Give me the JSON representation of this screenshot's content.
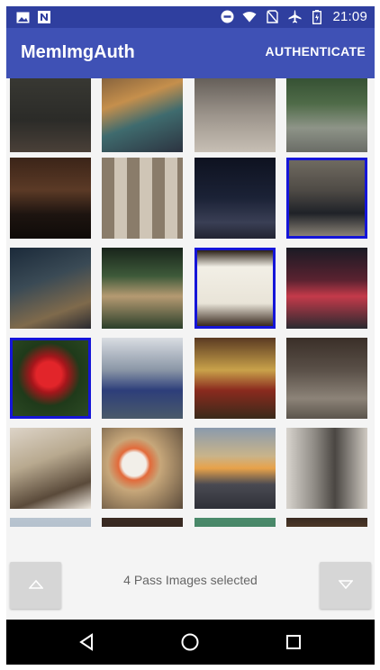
{
  "status_bar": {
    "time": "21:09",
    "left_icons": [
      "image-icon",
      "n-notification-icon"
    ],
    "right_icons": [
      "do-not-disturb-icon",
      "wifi-icon",
      "no-sim-icon",
      "airplane-icon",
      "battery-icon"
    ]
  },
  "app_bar": {
    "title": "MemImgAuth",
    "action_label": "AUTHENTICATE"
  },
  "grid": {
    "columns": 4,
    "selected_count": 4,
    "rows": [
      [
        {
          "name": "photo-red-bicycle",
          "selected": false
        },
        {
          "name": "photo-market-stall",
          "selected": false
        },
        {
          "name": "photo-street-sacks",
          "selected": false
        },
        {
          "name": "photo-tree-lined-road",
          "selected": false
        }
      ],
      [
        {
          "name": "photo-concert-hall",
          "selected": false
        },
        {
          "name": "photo-bookshelves",
          "selected": false
        },
        {
          "name": "photo-night-city",
          "selected": false
        },
        {
          "name": "photo-people-backpacks",
          "selected": true
        }
      ],
      [
        {
          "name": "photo-office-desk",
          "selected": false
        },
        {
          "name": "photo-pagoda-tree",
          "selected": false
        },
        {
          "name": "photo-sake-sign",
          "selected": true
        },
        {
          "name": "photo-neon-street",
          "selected": false
        }
      ],
      [
        {
          "name": "photo-red-rose",
          "selected": true
        },
        {
          "name": "photo-crowd-blue",
          "selected": false
        },
        {
          "name": "photo-lucky-figurine",
          "selected": false
        },
        {
          "name": "photo-exhibition-hall",
          "selected": false
        }
      ],
      [
        {
          "name": "photo-restaurant",
          "selected": false
        },
        {
          "name": "photo-food-bowl",
          "selected": false
        },
        {
          "name": "photo-sunset-city",
          "selected": false
        },
        {
          "name": "photo-apartment-room",
          "selected": false
        }
      ],
      [
        {
          "name": "photo-partial-sky",
          "selected": false
        },
        {
          "name": "photo-partial-dark",
          "selected": false
        },
        {
          "name": "photo-partial-shop",
          "selected": false
        },
        {
          "name": "photo-partial-lights",
          "selected": false
        }
      ]
    ]
  },
  "footer": {
    "selection_text": "4 Pass Images selected",
    "up_icon": "triangle-up-icon",
    "down_icon": "triangle-down-icon"
  },
  "nav_bar": {
    "icons": [
      "back-icon",
      "home-icon",
      "recents-icon"
    ]
  },
  "colors": {
    "status_bar": "#2f3f9f",
    "app_bar": "#3f51b5",
    "selection_border": "#1515d8"
  }
}
